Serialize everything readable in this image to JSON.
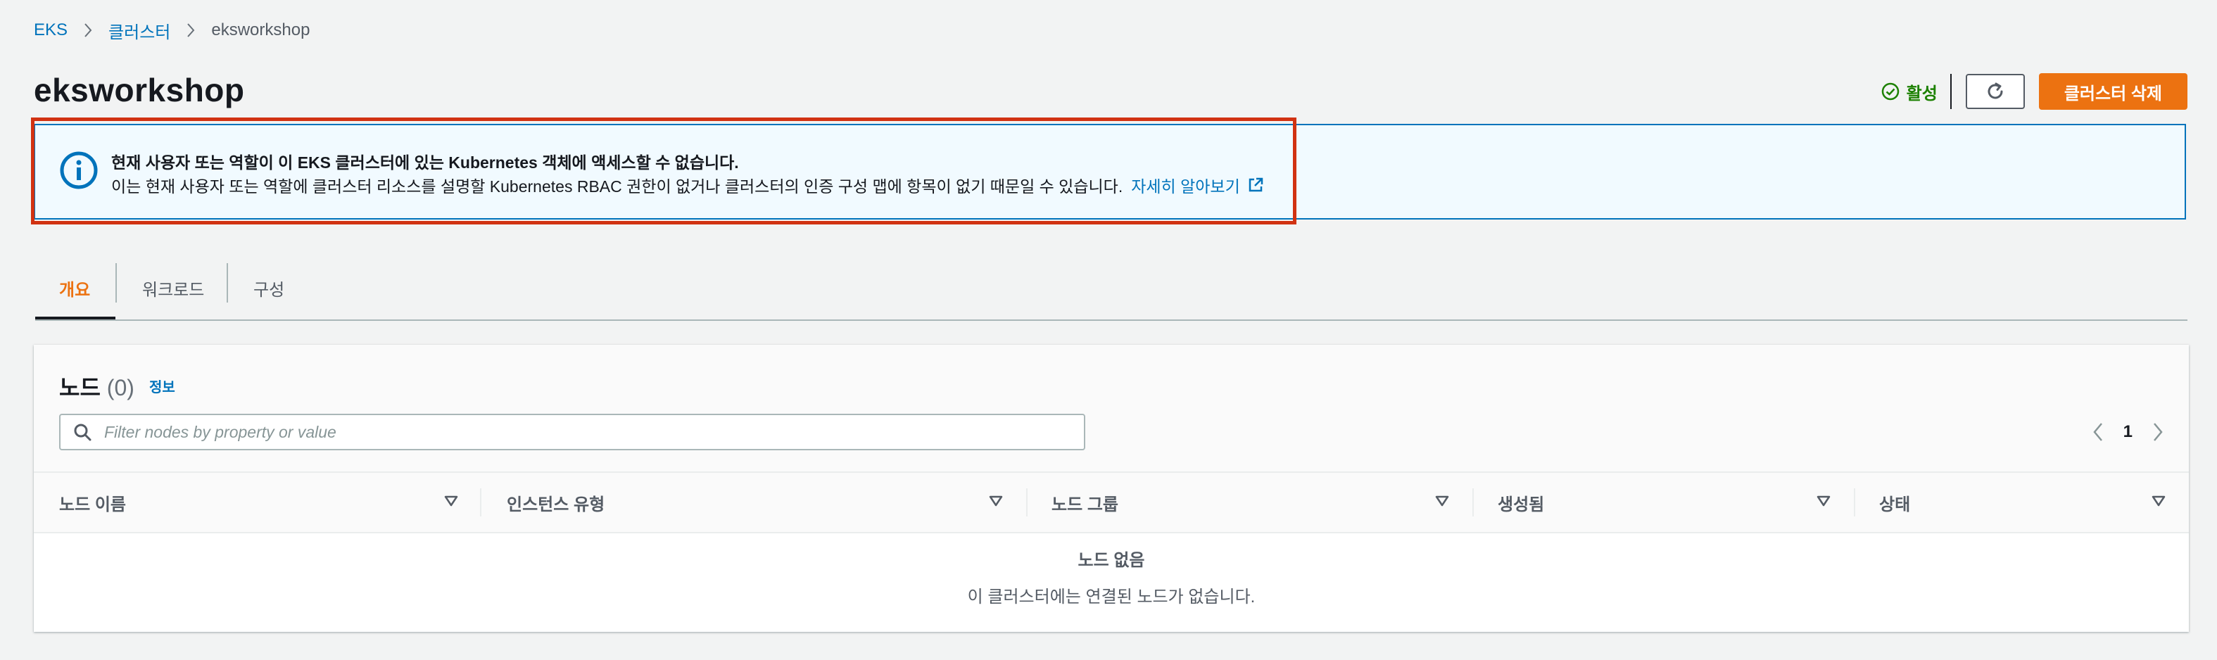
{
  "breadcrumb": {
    "root": "EKS",
    "clusters": "클러스터",
    "current": "eksworkshop"
  },
  "header": {
    "title": "eksworkshop",
    "status": "활성",
    "status_icon": "check-circle-icon",
    "refresh_icon": "refresh-icon",
    "delete_label": "클러스터 삭제"
  },
  "banner": {
    "icon": "info-icon",
    "title": "현재 사용자 또는 역할이 이 EKS 클러스터에 있는 Kubernetes 객체에 액세스할 수 없습니다.",
    "body": "이는 현재 사용자 또는 역할에 클러스터 리소스를 설명할 Kubernetes RBAC 권한이 없거나 클러스터의 인증 구성 맵에 항목이 없기 때문일 수 있습니다.",
    "link": "자세히 알아보기",
    "link_icon": "external-link-icon"
  },
  "tabs": [
    {
      "label": "개요",
      "active": true
    },
    {
      "label": "워크로드",
      "active": false
    },
    {
      "label": "구성",
      "active": false
    }
  ],
  "nodes": {
    "title": "노드",
    "count": "(0)",
    "info_link": "정보",
    "search_placeholder": "Filter nodes by property or value",
    "page": "1",
    "columns": [
      "노드 이름",
      "인스턴스 유형",
      "노드 그룹",
      "생성됨",
      "상태"
    ],
    "empty_title": "노드 없음",
    "empty_text": "이 클러스터에는 연결된 노드가 없습니다."
  },
  "colors": {
    "accent": "#ec7211",
    "link": "#0073bb",
    "success": "#1d8102",
    "highlight": "#d13212",
    "info_bg": "#f1faff"
  }
}
